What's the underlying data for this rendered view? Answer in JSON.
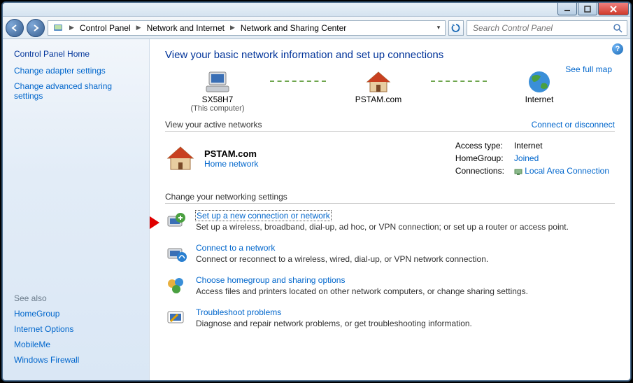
{
  "titlebar": {
    "minimize_label": "Minimize",
    "maximize_label": "Maximize",
    "close_label": "Close"
  },
  "breadcrumbs": {
    "items": [
      "Control Panel",
      "Network and Internet",
      "Network and Sharing Center"
    ]
  },
  "search": {
    "placeholder": "Search Control Panel"
  },
  "sidebar": {
    "home": "Control Panel Home",
    "links": [
      "Change adapter settings",
      "Change advanced sharing settings"
    ],
    "seealso_title": "See also",
    "seealso": [
      "HomeGroup",
      "Internet Options",
      "MobileMe",
      "Windows Firewall"
    ]
  },
  "page": {
    "title": "View your basic network information and set up connections",
    "fullmap": "See full map",
    "nodes": {
      "computer_name": "SX58H7",
      "computer_sub": "(This computer)",
      "domain": "PSTAM.com",
      "internet": "Internet"
    },
    "active_section": "View your active networks",
    "active_rightlink": "Connect or disconnect",
    "active_net": {
      "name": "PSTAM.com",
      "type_link": "Home network",
      "details": {
        "access_label": "Access type:",
        "access_value": "Internet",
        "homegroup_label": "HomeGroup:",
        "homegroup_link": "Joined",
        "connections_label": "Connections:",
        "connections_link": "Local Area Connection"
      }
    },
    "change_section": "Change your networking settings",
    "tasks": [
      {
        "title": "Set up a new connection or network",
        "desc": "Set up a wireless, broadband, dial-up, ad hoc, or VPN connection; or set up a router or access point."
      },
      {
        "title": "Connect to a network",
        "desc": "Connect or reconnect to a wireless, wired, dial-up, or VPN network connection."
      },
      {
        "title": "Choose homegroup and sharing options",
        "desc": "Access files and printers located on other network computers, or change sharing settings."
      },
      {
        "title": "Troubleshoot problems",
        "desc": "Diagnose and repair network problems, or get troubleshooting information."
      }
    ]
  }
}
